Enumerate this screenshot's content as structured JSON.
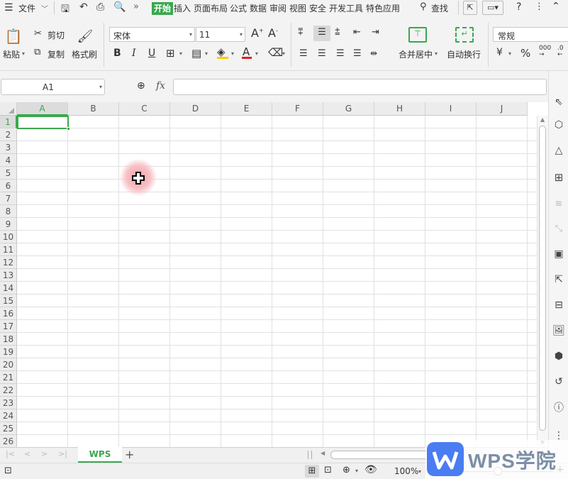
{
  "menu": {
    "file": "文件",
    "tabs": [
      "开始",
      "插入",
      "页面布局",
      "公式",
      "数据",
      "审阅",
      "视图",
      "安全",
      "开发工具",
      "特色应用"
    ],
    "search": "查找"
  },
  "ribbon": {
    "paste": "粘贴",
    "cut": "剪切",
    "copy": "复制",
    "format_painter": "格式刷",
    "font_name": "宋体",
    "font_size": "11",
    "merge_center": "合并居中",
    "wrap_text": "自动换行",
    "number_format": "常规"
  },
  "formula_bar": {
    "name_box": "A1",
    "fx": "fx",
    "value": ""
  },
  "grid": {
    "columns": [
      "A",
      "B",
      "C",
      "D",
      "E",
      "F",
      "G",
      "H",
      "I",
      "J"
    ],
    "rows": [
      "1",
      "2",
      "3",
      "4",
      "5",
      "6",
      "7",
      "8",
      "9",
      "10",
      "11",
      "12",
      "13",
      "14",
      "15",
      "16",
      "17",
      "18",
      "19",
      "20",
      "21",
      "22",
      "23",
      "24",
      "25",
      "26"
    ],
    "selected_cell": "A1"
  },
  "sheet_tabs": {
    "active": "WPS",
    "add": "+"
  },
  "status": {
    "zoom": "100%"
  },
  "watermark": {
    "brand": "WPS学院"
  },
  "colors": {
    "accent": "#3aa84e",
    "watermark_blue": "#4a7cf2",
    "cursor_glow": "#f7b8bd"
  }
}
